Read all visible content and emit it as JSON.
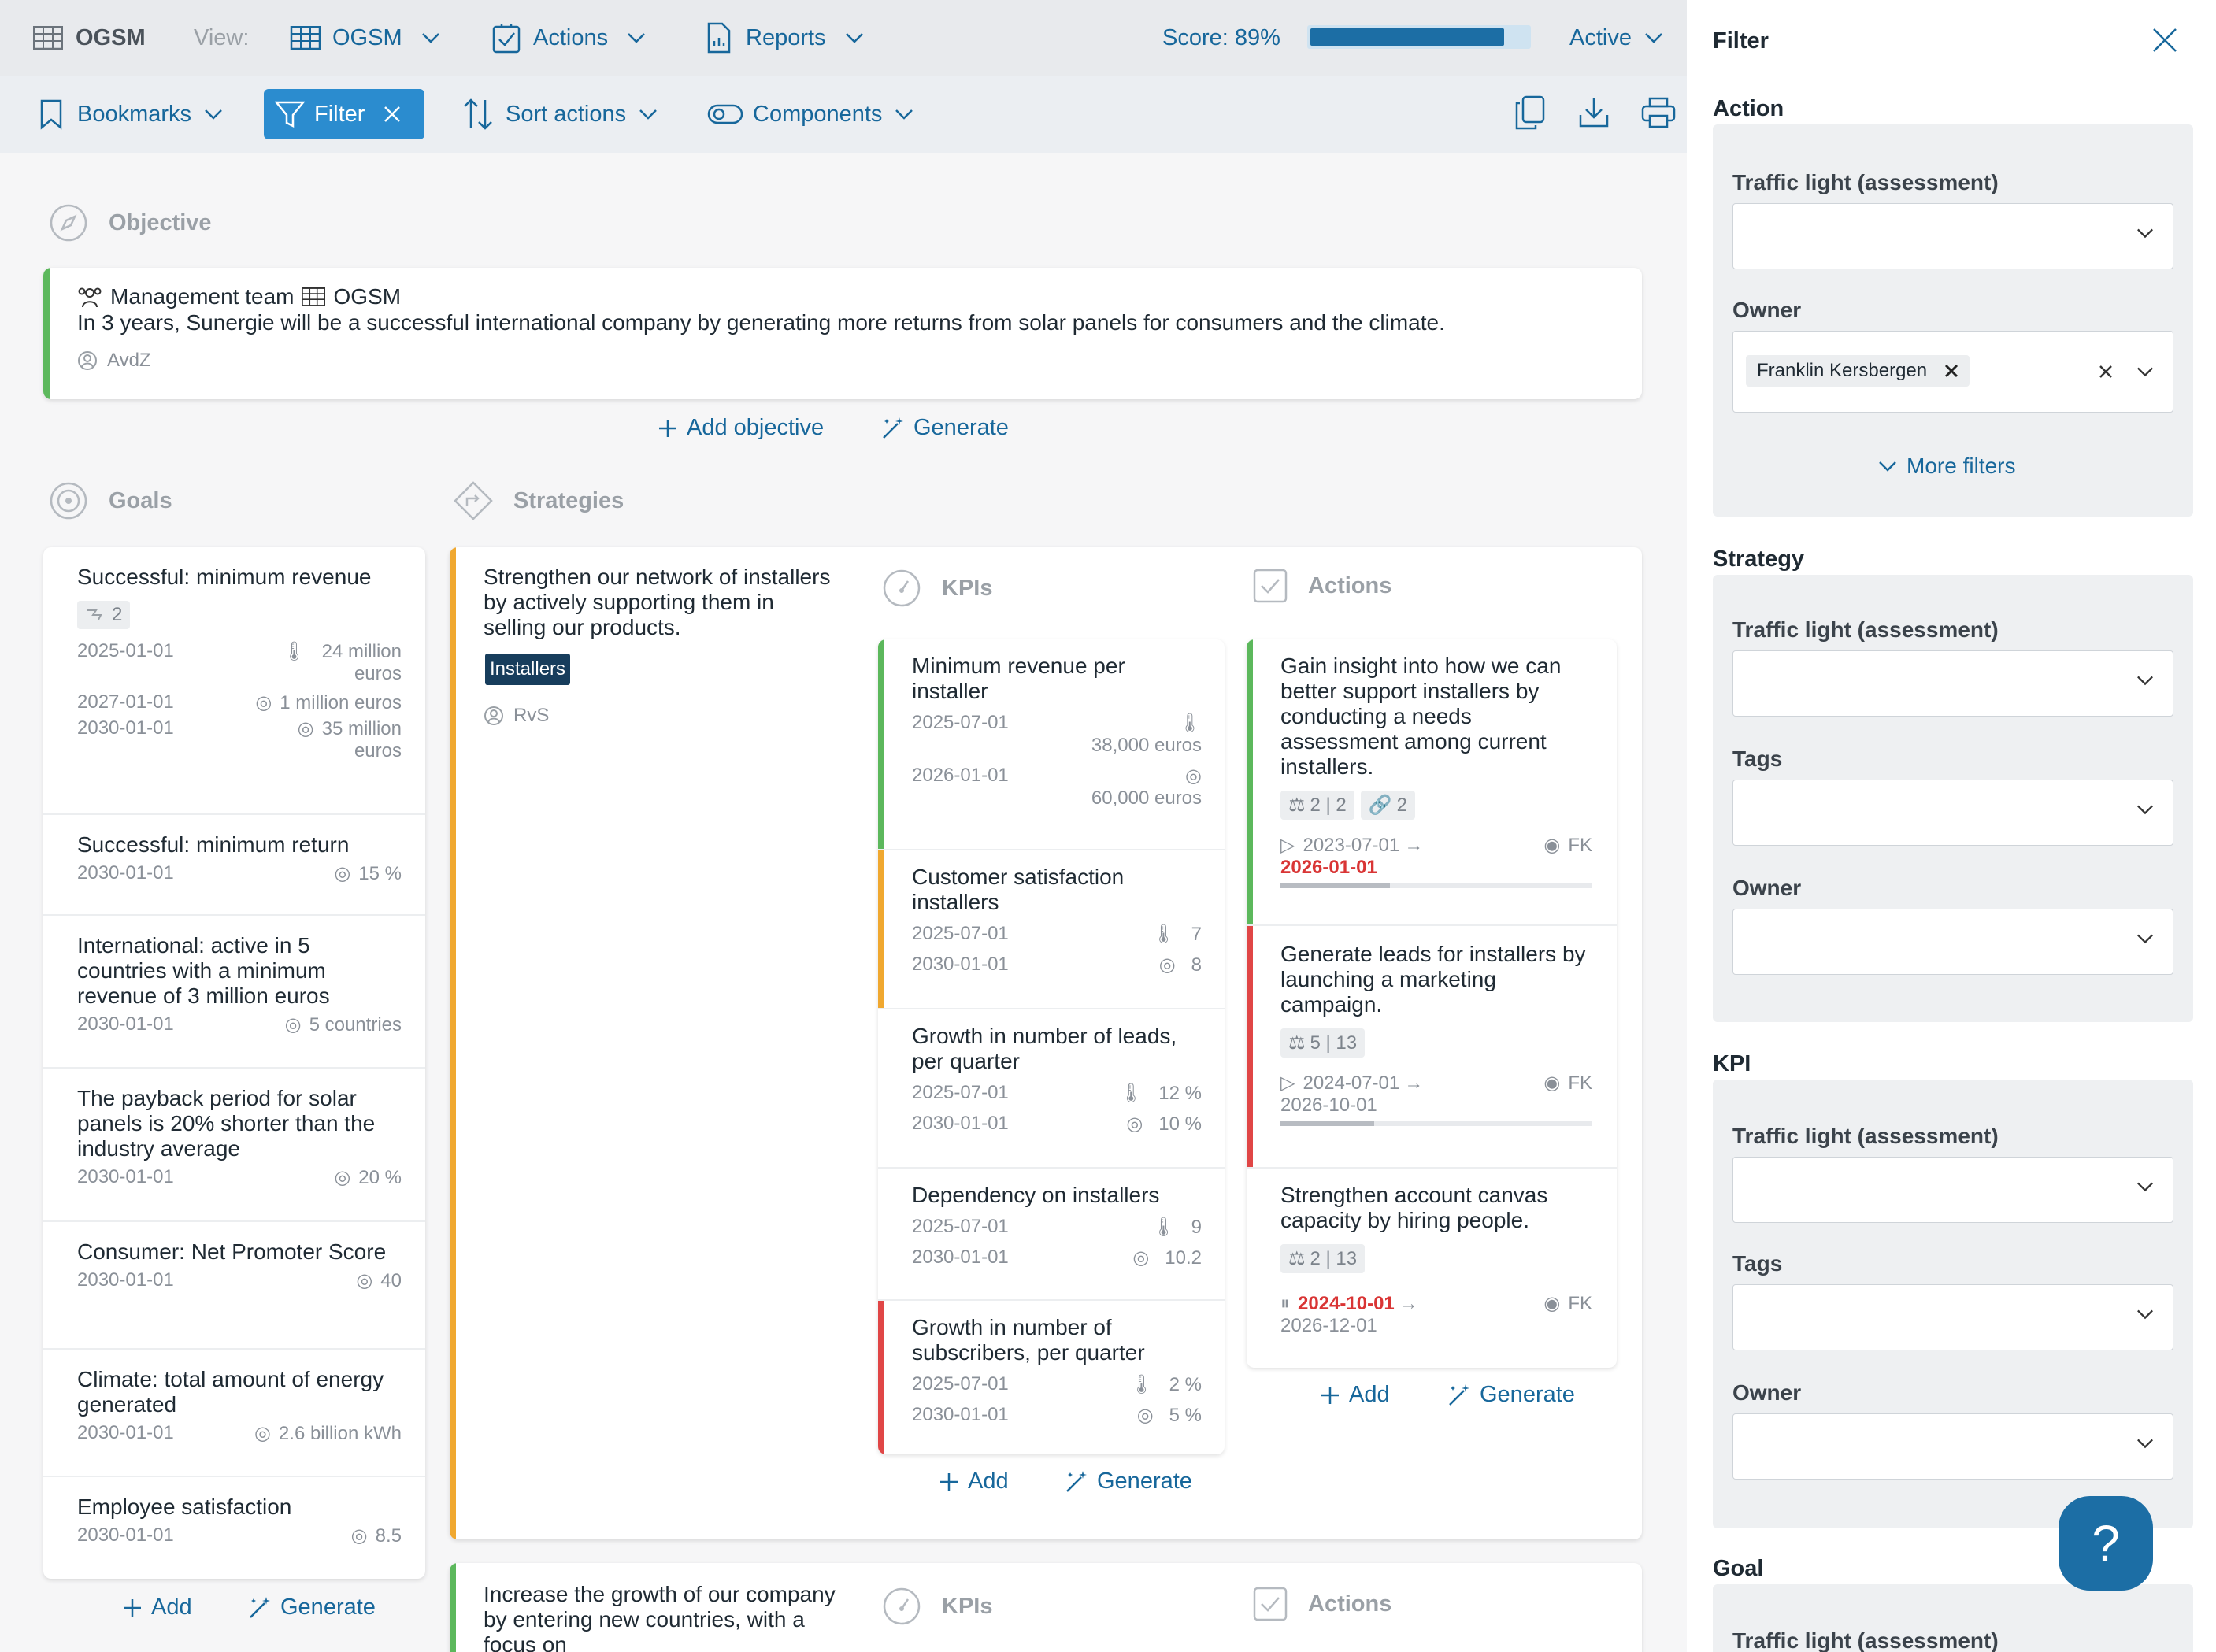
{
  "top": {
    "app": "OGSM",
    "view_label": "View:",
    "view_value": "OGSM",
    "actions": "Actions",
    "reports": "Reports",
    "score": "Score: 89%",
    "score_value": 0.89,
    "status": "Active"
  },
  "toolbar": {
    "bookmarks": "Bookmarks",
    "filter": "Filter",
    "sort": "Sort actions",
    "components": "Components"
  },
  "objective": {
    "title": "Objective",
    "team": "Management team",
    "view": "OGSM",
    "text": "In 3 years, Sunergie will be a successful international company by generating more returns from solar panels for consumers and the climate.",
    "owner": "AvdZ",
    "add": "Add objective",
    "generate": "Generate"
  },
  "goals": {
    "title": "Goals",
    "items": [
      {
        "name": "Successful: minimum revenue",
        "badge": "2",
        "d1": "2025-01-01",
        "v1a": "24 million",
        "v1b": "euros",
        "d2": "2027-01-01",
        "v2": "1 million euros",
        "d3": "2030-01-01",
        "v3a": "35 million",
        "v3b": "euros"
      },
      {
        "name": "Successful: minimum return",
        "d1": "2030-01-01",
        "v1": "15 %"
      },
      {
        "name": "International: active in 5 countries with a minimum revenue of 3 million euros",
        "d1": "2030-01-01",
        "v1": "5 countries"
      },
      {
        "name": "The payback period for solar panels is 20% shorter than the industry average",
        "d1": "2030-01-01",
        "v1": "20 %"
      },
      {
        "name": "Consumer: Net Promoter Score",
        "d1": "2030-01-01",
        "v1": "40"
      },
      {
        "name": "Climate: total amount of energy generated",
        "d1": "2030-01-01",
        "v1": "2.6 billion kWh"
      },
      {
        "name": "Employee satisfaction",
        "d1": "2030-01-01",
        "v1": "8.5"
      }
    ],
    "add": "Add",
    "generate": "Generate"
  },
  "strategies": {
    "title": "Strategies",
    "s1": {
      "text": "Strengthen our network of installers by actively supporting them in selling our products.",
      "tag": "Installers",
      "owner": "RvS"
    },
    "s2": {
      "text": "Increase the growth of our company by entering new countries, with a focus on"
    }
  },
  "kpis": {
    "title": "KPIs",
    "items": [
      {
        "name": "Minimum revenue per installer",
        "d1": "2025-07-01",
        "v1": "38,000 euros",
        "d2": "2026-01-01",
        "v2": "60,000 euros",
        "color": "#5cb85c"
      },
      {
        "name": "Customer satisfaction installers",
        "d1": "2025-07-01",
        "v1": "7",
        "d2": "2030-01-01",
        "v2": "8",
        "color": "#f0a830"
      },
      {
        "name": "Growth in number of leads, per quarter",
        "d1": "2025-07-01",
        "v1": "12 %",
        "d2": "2030-01-01",
        "v2": "10 %",
        "color": "#ffffff"
      },
      {
        "name": "Dependency on installers",
        "d1": "2025-07-01",
        "v1": "9",
        "d2": "2030-01-01",
        "v2": "10.2",
        "color": "#ffffff"
      },
      {
        "name": "Growth in number of subscribers, per quarter",
        "d1": "2025-07-01",
        "v1": "2 %",
        "d2": "2030-01-01",
        "v2": "5 %",
        "color": "#e04646"
      }
    ],
    "add": "Add",
    "generate": "Generate"
  },
  "actions": {
    "title": "Actions",
    "items": [
      {
        "name": "Gain insight into how we can better support installers by conducting a needs assessment among current installers.",
        "b1": "2 | 2",
        "b2": "2",
        "start": "2023-07-01",
        "end": "2026-01-01",
        "owner": "FK",
        "progress": 0.35,
        "color": "#5cb85c"
      },
      {
        "name": "Generate leads for installers by launching a marketing campaign.",
        "b1": "5 | 13",
        "start": "2024-07-01",
        "end": "2026-10-01",
        "owner": "FK",
        "progress": 0.3,
        "color": "#e04646"
      },
      {
        "name": "Strengthen account canvas capacity by hiring people.",
        "b1": "2 | 13",
        "start": "2024-10-01",
        "end": "2026-12-01",
        "owner": "FK",
        "color": "#ffffff"
      }
    ],
    "add": "Add",
    "generate": "Generate"
  },
  "filter": {
    "title": "Filter",
    "action": "Action",
    "traffic": "Traffic light (assessment)",
    "owner": "Owner",
    "owner_value": "Franklin Kersbergen",
    "more": "More filters",
    "strategy": "Strategy",
    "tags": "Tags",
    "kpi": "KPI",
    "goal": "Goal"
  },
  "help": "?"
}
